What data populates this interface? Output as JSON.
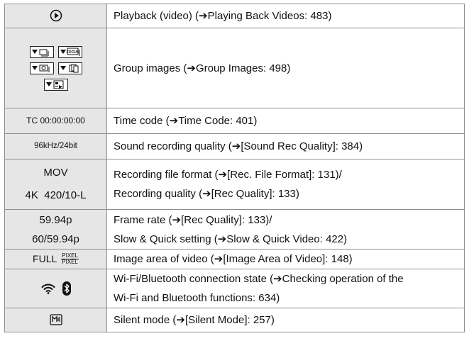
{
  "rows": [
    {
      "icon_name": "playback-icon",
      "desc": [
        "Playback (video) (➔Playing Back Videos: 483)"
      ]
    },
    {
      "icon_names": [
        "group-burst-icon",
        "group-focus-bracket-icon",
        "group-interval-icon",
        "group-stop-motion-icon",
        "group-focus-stacking-icon"
      ],
      "group_badge": "FOCUS",
      "desc": [
        "Group images (➔Group Images: 498)"
      ]
    },
    {
      "symbols": [
        "TC 00:00:00:00"
      ],
      "desc": [
        "Time code (➔Time Code: 401)"
      ]
    },
    {
      "symbols": [
        "96kHz/24bit"
      ],
      "desc": [
        "Sound recording quality (➔[Sound Rec Quality]: 384)"
      ]
    },
    {
      "symbols": [
        "MOV",
        "4K  420/10-L"
      ],
      "desc": [
        "Recording file format (➔[Rec. File Format]: 131)/",
        "Recording quality (➔[Rec Quality]: 133)"
      ]
    },
    {
      "symbols": [
        "59.94p",
        "60/59.94p"
      ],
      "desc": [
        "Frame rate (➔[Rec Quality]: 133)/",
        "Slow & Quick setting (➔Slow & Quick Video: 422)"
      ]
    },
    {
      "symbol_full": "FULL",
      "frac_num": "PIXEL",
      "frac_den": "PIXEL",
      "desc": [
        "Image area of video (➔[Image Area of Video]: 148)"
      ]
    },
    {
      "icon_names": [
        "wifi-icon",
        "bluetooth-icon"
      ],
      "desc": [
        "Wi-Fi/Bluetooth connection state (➔Checking operation of the",
        "Wi-Fi and Bluetooth functions: 634)"
      ]
    },
    {
      "icon_name": "silent-mode-icon",
      "desc": [
        "Silent mode (➔[Silent Mode]: 257)"
      ]
    }
  ]
}
